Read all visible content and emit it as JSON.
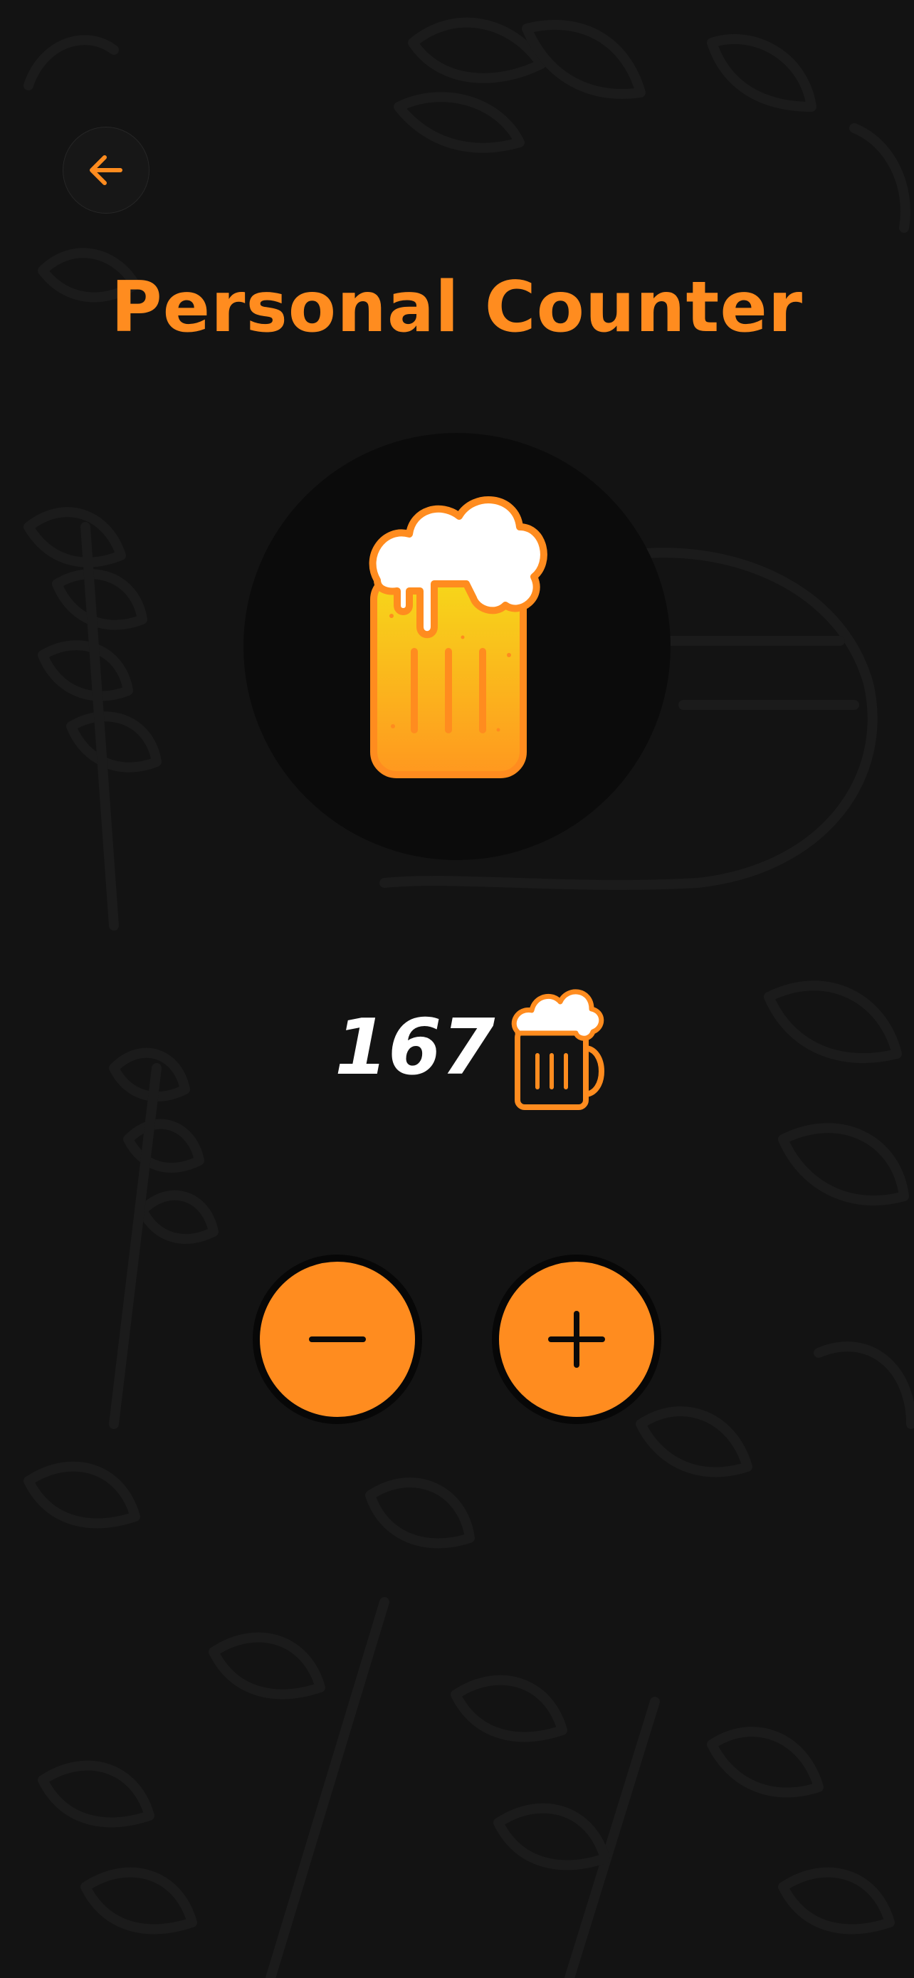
{
  "header": {
    "back_icon": "arrow-left-icon",
    "title": "Personal Counter"
  },
  "hero": {
    "icon": "beer-glass-icon"
  },
  "counter": {
    "value": "167",
    "unit_icon": "beer-mug-icon"
  },
  "controls": {
    "decrement_icon": "minus-icon",
    "increment_icon": "plus-icon"
  },
  "background": {
    "pattern": "hops-and-leaves-pattern"
  },
  "colors": {
    "background": "#131313",
    "accent": "#ff8c1f",
    "hero_circle": "#0b0b0b",
    "beer_top": "#f6d81a",
    "beer_bottom": "#ff9a1f",
    "foam": "#ffffff",
    "text": "#ffffff"
  }
}
